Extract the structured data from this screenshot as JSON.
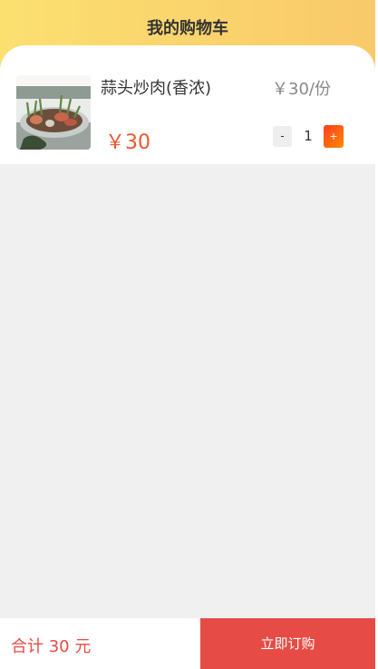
{
  "header": {
    "title": "我的购物车"
  },
  "cart": {
    "items": [
      {
        "name": "蒜头炒肉(香浓)",
        "unit_price": "￥30/份",
        "price": "￥30",
        "quantity": "1",
        "minus_label": "-",
        "plus_label": "+",
        "image": "food-photo"
      }
    ]
  },
  "footer": {
    "total": "合计 30 元",
    "order_label": "立即订购"
  },
  "colors": {
    "header_gradient_start": "#fbe070",
    "header_gradient_end": "#f9c96a",
    "price": "#f0552a",
    "accent": "#e64c45",
    "background": "#f0f0f0"
  }
}
